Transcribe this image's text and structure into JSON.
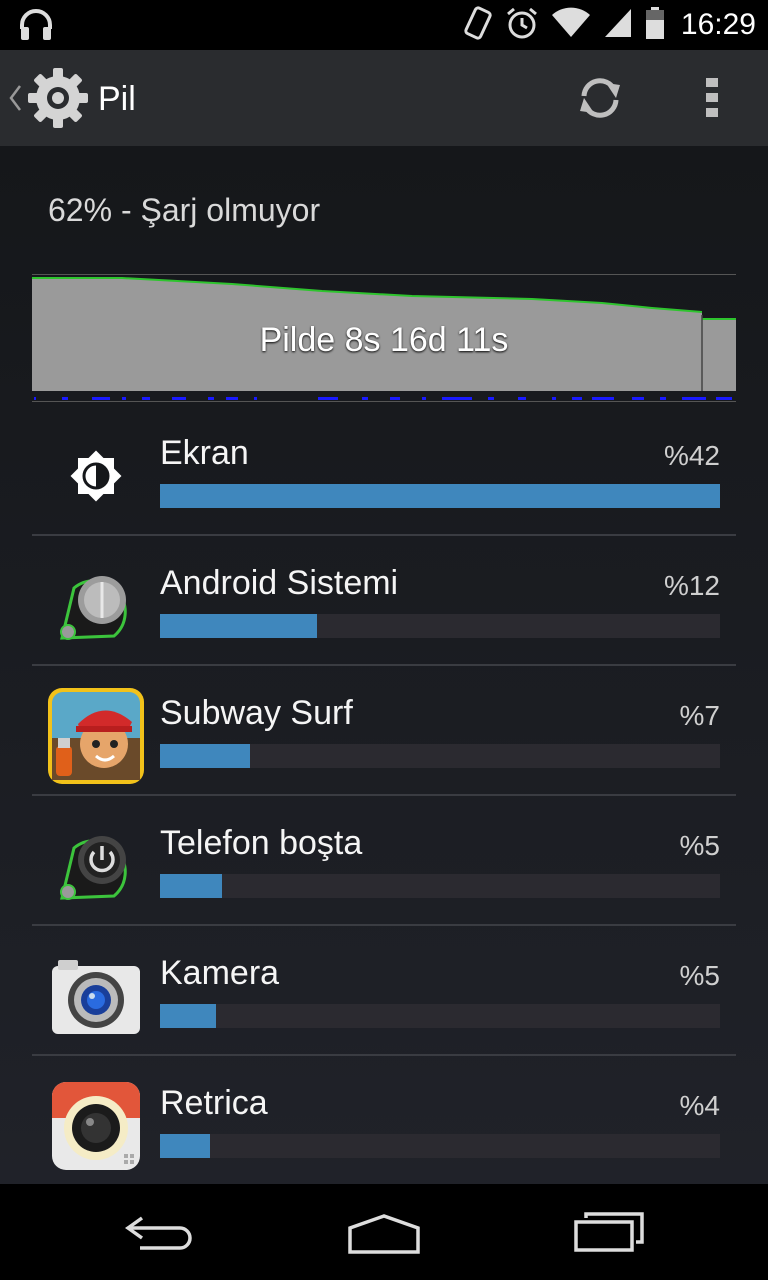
{
  "status_bar": {
    "time": "16:29",
    "icons": [
      "headphones-icon",
      "vibrate-icon",
      "alarm-icon",
      "wifi-icon",
      "signal-icon",
      "battery-icon"
    ]
  },
  "action_bar": {
    "title": "Pil",
    "icons": [
      "back-caret-icon",
      "settings-gear-icon",
      "refresh-icon",
      "overflow-menu-icon"
    ]
  },
  "battery": {
    "summary": "62% - Şarj olmuyor",
    "graph_label": "Pilde 8s 16d 11s"
  },
  "usage": [
    {
      "name": "Ekran",
      "percent": "%42",
      "fill": 1.0,
      "icon": "brightness-icon"
    },
    {
      "name": "Android Sistemi",
      "percent": "%12",
      "fill": 0.28,
      "icon": "android-system-icon"
    },
    {
      "name": "Subway Surf",
      "percent": "%7",
      "fill": 0.16,
      "icon": "subway-surf-icon"
    },
    {
      "name": "Telefon boşta",
      "percent": "%5",
      "fill": 0.11,
      "icon": "phone-idle-icon"
    },
    {
      "name": "Kamera",
      "percent": "%5",
      "fill": 0.1,
      "icon": "camera-icon"
    },
    {
      "name": "Retrica",
      "percent": "%4",
      "fill": 0.09,
      "icon": "retrica-icon"
    }
  ],
  "nav_bar": {
    "icons": [
      "back-icon",
      "home-icon",
      "recents-icon"
    ]
  },
  "colors": {
    "bar_fill": "#3f87bd",
    "bar_track": "#2b2a30",
    "graph_line": "#2ec42e",
    "graph_fill": "#9a9a9a",
    "charge_marks": "#1a1aff"
  }
}
